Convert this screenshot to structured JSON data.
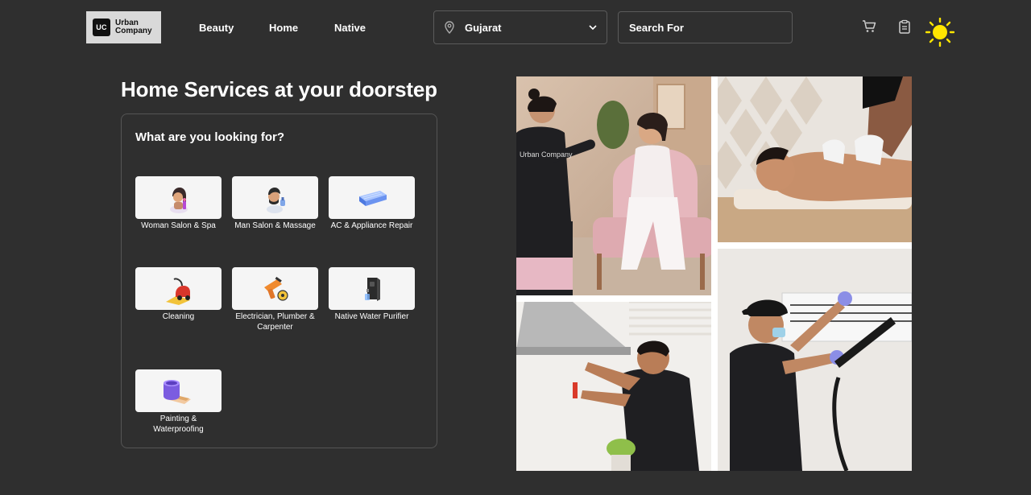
{
  "brand": {
    "mark": "UC",
    "line1": "Urban",
    "line2": "Company"
  },
  "nav": {
    "links": [
      "Beauty",
      "Home",
      "Native"
    ]
  },
  "location": {
    "value": "Gujarat"
  },
  "search": {
    "placeholder": "Search For"
  },
  "header_icons": [
    "cart-icon",
    "clipboard-icon",
    "sun-icon"
  ],
  "hero": {
    "title": "Home Services at your doorstep",
    "panel_title": "What are you looking for?",
    "services": [
      {
        "label": "Woman Salon & Spa"
      },
      {
        "label": "Man Salon & Massage"
      },
      {
        "label": "AC & Appliance Repair"
      },
      {
        "label": "Cleaning"
      },
      {
        "label": "Electrician, Plumber & Carpenter"
      },
      {
        "label": "Native Water Purifier"
      },
      {
        "label": "Painting & Waterproofing"
      }
    ]
  },
  "collage": {
    "photo_1_text": "Urban Company",
    "images": [
      "salon-at-home-photo",
      "massage-photo",
      "chimney-repair-photo",
      "ac-cleaning-photo"
    ]
  },
  "colors": {
    "background": "#2f2f2f",
    "sun": "#ffe600",
    "card": "#f5f5f5"
  }
}
